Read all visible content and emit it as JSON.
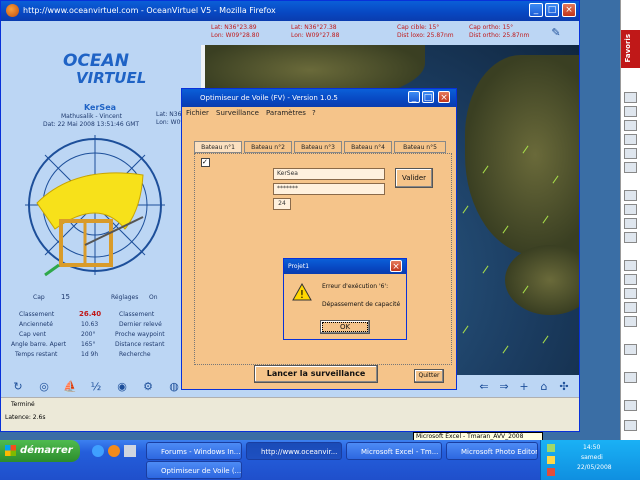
{
  "browser": {
    "title": "http://www.oceanvirtuel.com - OceanVirtuel V5 - Mozilla Firefox",
    "status_text": "Terminé",
    "status_extra": "Latence: 2.6s"
  },
  "game": {
    "logo_line1": "OCEAN",
    "logo_line2": "VIRTUEL",
    "boat_name": "KerSea",
    "boat_owner": "Mathusalik - Vincent",
    "boat_date": "Dat: 22 Mai 2008 13:51:46 GMT",
    "top_lat1": "Lat: N36°23.89",
    "top_lon1": "Lon: W09°28.80",
    "top_lat2": "Lat: N36°27.38",
    "top_lon2": "Lon: W09°27.88",
    "top_cap_label": "Cap cible: 15°",
    "top_cap2_label": "Cap ortho: 15°",
    "top_dist1": "Dist loxo: 25.87nm",
    "top_dist2": "Dist ortho: 25.87nm",
    "side_lat": "Lat: N36°...",
    "side_lon": "Lon: W09°...",
    "cap_label": "Cap",
    "cap_value": "15",
    "reglages_label": "Réglages",
    "reglages_value": "On",
    "stats": [
      {
        "label": "Classement",
        "value": "26.40",
        "label2": "Classement"
      },
      {
        "label": "Ancienneté",
        "value": "10.63",
        "label2": "Dernier relevé"
      },
      {
        "label": "Cap vent",
        "value": "200°",
        "label2": "Proche waypoint"
      },
      {
        "label": "Angle barre. Apert",
        "value": "165°",
        "label2": "Distance restant"
      },
      {
        "label": "Temps restant",
        "value": "1d 9h",
        "label2": "Recherche"
      }
    ]
  },
  "optimizer": {
    "title": "Optimiseur de Voile (FV) - Version 1.0.5",
    "menu": [
      "Fichier",
      "Surveillance",
      "Paramètres",
      "?"
    ],
    "tabs": [
      "Bateau n°1",
      "Bateau n°2",
      "Bateau n°3",
      "Bateau n°4",
      "Bateau n°5"
    ],
    "name_field": "KerSea",
    "password_field": "*******",
    "small_field": "24",
    "validate_label": "Valider",
    "launch_label": "Lancer la surveillance",
    "quit_label": "Quitter"
  },
  "error": {
    "title": "Projet1",
    "line1": "Erreur d'exécution '6':",
    "line2": "Dépassement de capacité",
    "ok_label": "OK"
  },
  "sidebar": {
    "label": "Favoris"
  },
  "taskbar": {
    "start_label": "démarrer",
    "tasks": [
      "Forums - Windows In...",
      "http://www.oceanvir...",
      "Microsoft Excel - Tm...",
      "Microsoft Photo Editor",
      "Optimiseur de Voile (..."
    ],
    "tooltip": "Microsoft Excel - Tmaran_AVV_2008",
    "clock_time": "14:50",
    "clock_day": "samedi",
    "clock_date": "22/05/2008"
  },
  "colors": {
    "xp_blue": "#0a5fd8",
    "panel_blue": "#bcd6f4",
    "dialog_peach": "#f5c48a",
    "red_accent": "#c01818"
  }
}
